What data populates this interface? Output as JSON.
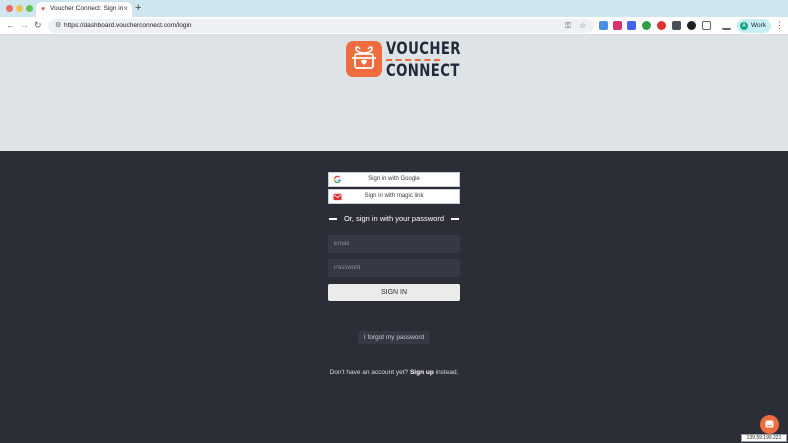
{
  "browser": {
    "tab_title": "Voucher Connect: Sign in",
    "tab_close": "×",
    "new_tab": "+",
    "url": "https://dashboard.voucherconnect.com/login",
    "profile_initial": "A",
    "profile_name": "Work"
  },
  "logo": {
    "line1": "VOUCHER",
    "line2": "CONNECT"
  },
  "login": {
    "google_label": "Sign in with Google",
    "magic_label": "Sign in with magic link",
    "divider_text": "Or, sign in with your password",
    "email_placeholder": "Email",
    "password_placeholder": "Password",
    "submit_label": "SIGN IN",
    "forgot_label": "I forgot my password",
    "signup_prefix": "Don't have an account yet?",
    "signup_link": "Sign up",
    "signup_suffix": "instead."
  },
  "footer": {
    "ip": "139.59.199.221"
  },
  "colors": {
    "brand_orange": "#ef6c3e",
    "logo_navy": "#1f2a3a",
    "panel_bg": "#2b2e37",
    "hero_bg": "#dde3e6"
  }
}
